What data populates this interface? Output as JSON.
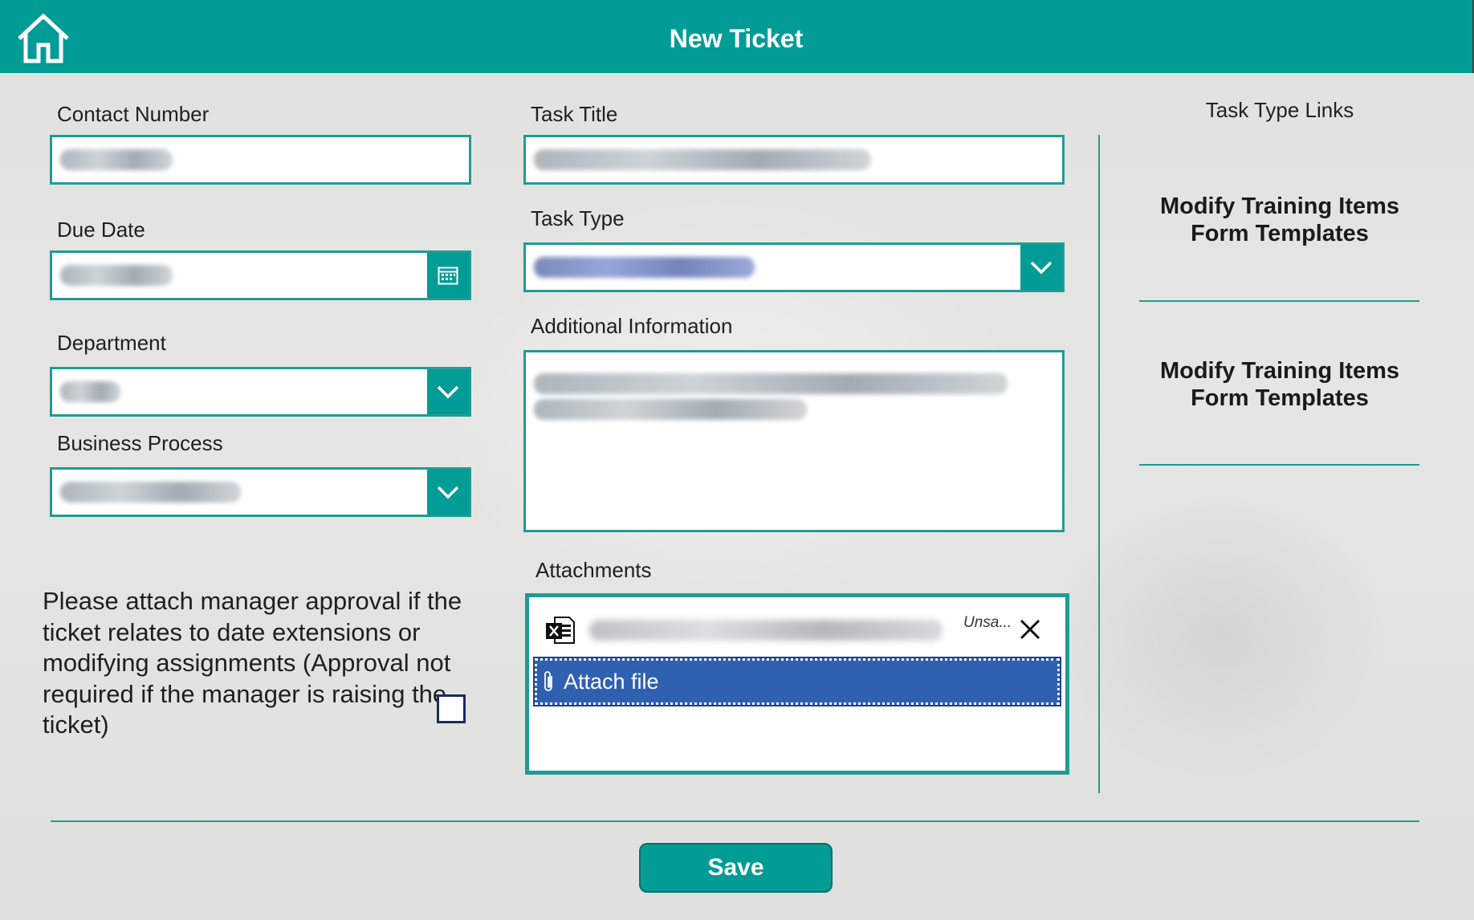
{
  "header": {
    "title": "New Ticket",
    "home_icon": "home-icon"
  },
  "form": {
    "contact_number": {
      "label": "Contact Number",
      "value": ""
    },
    "due_date": {
      "label": "Due Date",
      "value": "",
      "icon": "calendar-icon"
    },
    "department": {
      "label": "Department",
      "value": "",
      "icon": "chevron-down-icon"
    },
    "business_process": {
      "label": "Business Process",
      "value": "",
      "icon": "chevron-down-icon"
    },
    "task_title": {
      "label": "Task Title",
      "value": ""
    },
    "task_type": {
      "label": "Task Type",
      "value": "",
      "icon": "chevron-down-icon"
    },
    "additional_information": {
      "label": "Additional Information",
      "value": ""
    },
    "approval_note": "Please attach manager approval if the ticket relates to date extensions or modifying assignments (Approval not required if the manager is raising the ticket)",
    "approval_checked": false
  },
  "attachments": {
    "label": "Attachments",
    "files": [
      {
        "status": "Unsa...",
        "icon": "excel-file-icon",
        "remove_icon": "close-icon"
      }
    ],
    "attach_label": "Attach file",
    "attach_icon": "paperclip-icon"
  },
  "links": {
    "heading": "Task Type Links",
    "items": [
      {
        "label": "Modify Training Items Form Templates"
      },
      {
        "label": "Modify Training Items Form Templates"
      }
    ]
  },
  "actions": {
    "save_label": "Save"
  },
  "colors": {
    "accent": "#019c95",
    "attach_button": "#3060b0"
  }
}
